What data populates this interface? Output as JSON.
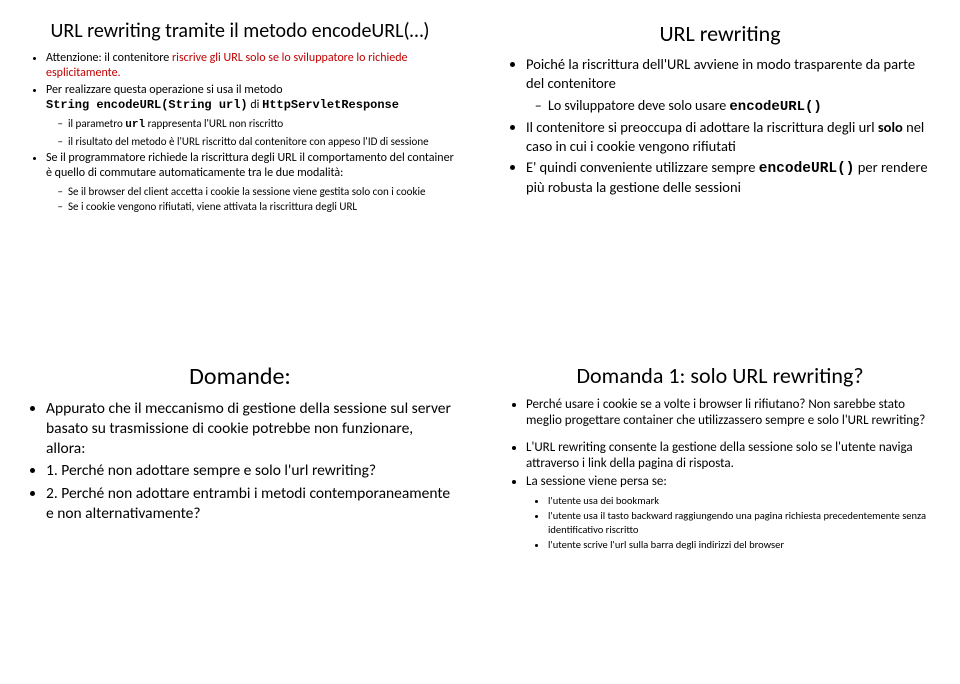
{
  "s1": {
    "title": "URL rewriting tramite il metodo encodeURL(…)",
    "b1": "Attenzione: il contenitore ",
    "b1red": "riscrive gli URL solo se lo sviluppatore lo richiede esplicitamente.",
    "b2a": "Per realizzare questa operazione si usa il metodo",
    "b2code": "String encodeURL(String url)",
    "b2b": " di ",
    "b2code2": "HttpServletResponse",
    "b2s1a": "il parametro ",
    "b2s1code": "url",
    "b2s1b": " rappresenta l'URL non riscritto",
    "b2s2": "il risultato del metodo è l'URL riscritto dal contenitore con appeso l'ID di sessione",
    "b3": "Se il programmatore richiede la riscrittura degli URL il comportamento del container è quello di commutare automaticamente tra le due modalità:",
    "b3s1": "Se il browser del client accetta i cookie la sessione viene gestita solo con i cookie",
    "b3s2": "Se i cookie vengono rifiutati, viene attivata la riscrittura degli URL"
  },
  "s2": {
    "title": "URL rewriting",
    "b1": "Poiché la riscrittura dell'URL avviene in modo trasparente da parte del contenitore",
    "b1s1a": "Lo sviluppatore deve solo usare ",
    "b1s1code": "encodeURL()",
    "b2a": "Il contenitore si preoccupa di adottare la riscrittura degli url ",
    "b2bold": "solo",
    "b2b": " nel caso in cui i cookie vengono rifiutati",
    "b3a": "E' quindi conveniente utilizzare sempre ",
    "b3code": "encodeURL()",
    "b3b": " per rendere più robusta la gestione delle sessioni"
  },
  "s3": {
    "title": "Domande:",
    "b1": "Appurato che il meccanismo di gestione della sessione sul server basato su trasmissione di cookie potrebbe non funzionare, allora:",
    "b2": "1. Perché non adottare sempre e solo l'url rewriting?",
    "b3": "2. Perché non adottare entrambi i metodi contemporaneamente e non alternativamente?"
  },
  "s4": {
    "title": "Domanda 1: solo URL rewriting?",
    "b1": "Perché usare i cookie se a volte i browser li rifiutano? Non sarebbe stato meglio progettare container che utilizzassero sempre e solo l'URL rewriting?",
    "b2": "L'URL rewriting consente la gestione della sessione solo se l'utente naviga attraverso i link della pagina di risposta.",
    "b3": "La sessione viene persa se:",
    "b3s1": "l'utente usa dei bookmark",
    "b3s2": "l'utente usa il tasto backward raggiungendo una pagina richiesta precedentemente senza identificativo riscritto",
    "b3s3": "l'utente scrive l'url sulla barra degli indirizzi del browser"
  }
}
